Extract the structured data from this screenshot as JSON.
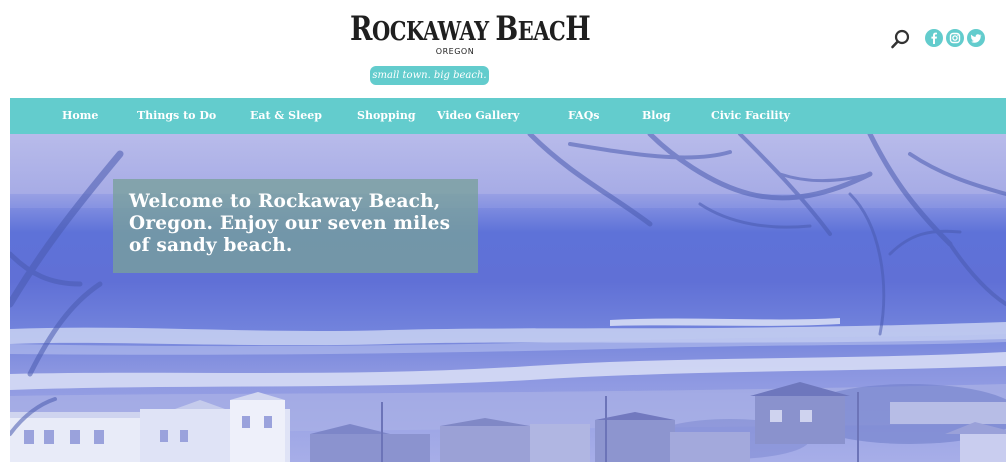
{
  "logo": {
    "title_first": "R",
    "title_mid": "OCKAWAY ",
    "title_b": "B",
    "title_end": "EAC",
    "title_last": "H",
    "subtitle": "OREGON",
    "tagline": "small town. big beach."
  },
  "header": {
    "search_icon": "search-icon",
    "social": [
      "facebook-icon",
      "instagram-icon",
      "twitter-icon"
    ],
    "accent_color": "#63cccd"
  },
  "nav": {
    "items": [
      {
        "label": "Home"
      },
      {
        "label": "Things to Do"
      },
      {
        "label": "Eat & Sleep"
      },
      {
        "label": "Shopping"
      },
      {
        "label": "Video Gallery"
      },
      {
        "label": "FAQs"
      },
      {
        "label": "Blog"
      },
      {
        "label": "Civic Facility"
      }
    ]
  },
  "hero": {
    "welcome_text": "Welcome to Rockaway Beach, Oregon. Enjoy our seven miles of sandy beach."
  }
}
